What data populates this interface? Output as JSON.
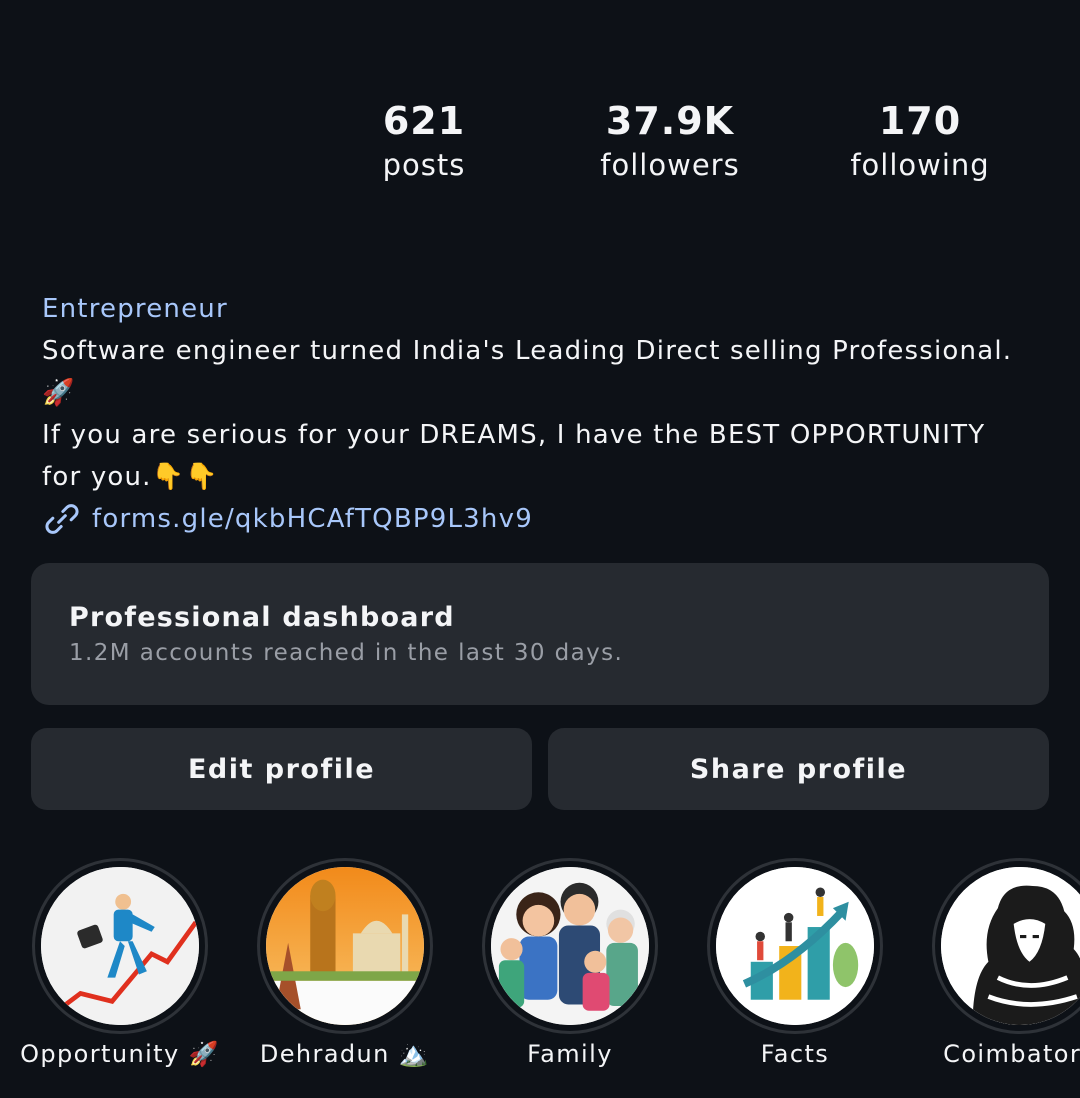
{
  "stats": {
    "posts": {
      "value": "621",
      "label": "posts"
    },
    "followers": {
      "value": "37.9K",
      "label": "followers"
    },
    "following": {
      "value": "170",
      "label": "following"
    }
  },
  "bio": {
    "category": "Entrepreneur",
    "line1": "Software engineer turned India's Leading Direct selling Professional.",
    "line2": "🚀",
    "line3": "If you are serious for your DREAMS, I have the BEST OPPORTUNITY",
    "line4": "for you.👇👇",
    "link": "forms.gle/qkbHCAfTQBP9L3hv9",
    "link_icon": "link-icon"
  },
  "dashboard": {
    "title": "Professional dashboard",
    "subtitle": "1.2M accounts reached in the last 30 days."
  },
  "buttons": {
    "edit": "Edit profile",
    "share": "Share profile"
  },
  "highlights": [
    {
      "label": "Opportunity 🚀"
    },
    {
      "label": "Dehradun 🏔️"
    },
    {
      "label": "Family"
    },
    {
      "label": "Facts"
    },
    {
      "label": "Coimbatore"
    }
  ],
  "colors": {
    "background": "#0d1117",
    "card": "#262a30",
    "link": "#a8c7fa",
    "muted": "#9a9ea6"
  }
}
